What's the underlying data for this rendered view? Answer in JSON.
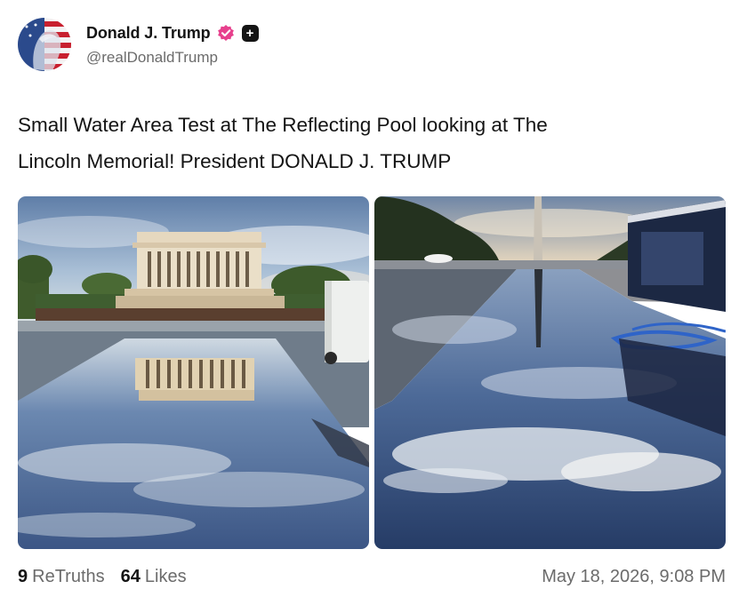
{
  "author": {
    "display_name": "Donald J. Trump",
    "handle": "@realDonaldTrump",
    "verified_badge_icon": "verified-badge-icon",
    "plus_icon": "plus-square-icon",
    "colors": {
      "verified": "#e7408d"
    }
  },
  "post": {
    "text_line1": "Small Water Area Test at The Reflecting Pool looking at The",
    "text_line2": "Lincoln Memorial! President DONALD J. TRUMP",
    "images": [
      {
        "subject": "Lincoln Memorial reflected in pool water"
      },
      {
        "subject": "Washington Monument reflected in pool water beside trailer"
      }
    ]
  },
  "stats": {
    "retruths_count": "9",
    "retruths_label": "ReTruths",
    "likes_count": "64",
    "likes_label": "Likes",
    "timestamp": "May 18, 2026, 9:08 PM"
  }
}
